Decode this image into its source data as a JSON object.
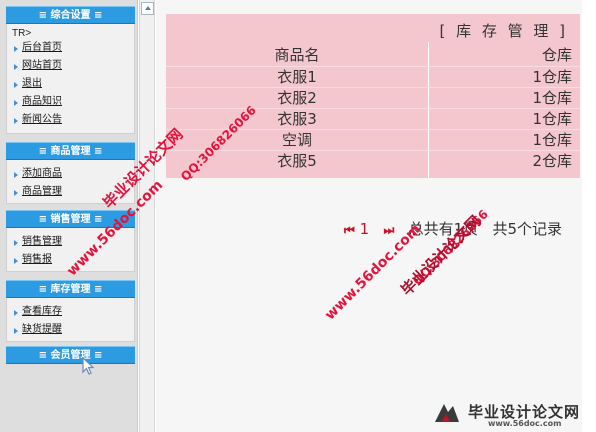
{
  "sidebar": {
    "sections": [
      {
        "title": "≡ 综合设置 ≡",
        "items": [
          "后台首页",
          "网站首页",
          "退出",
          "商品知识",
          "新闻公告"
        ]
      },
      {
        "title": "≡ 商品管理 ≡",
        "items": [
          "添加商品",
          "商品管理"
        ]
      },
      {
        "title": "≡ 销售管理 ≡",
        "items": [
          "销售管理",
          "销售报"
        ]
      },
      {
        "title": "≡ 库存管理 ≡",
        "items": [
          "查看库存",
          "缺货提醒"
        ]
      },
      {
        "title": "≡ 会员管理 ≡",
        "items": []
      }
    ],
    "tr_label": "TR>"
  },
  "table": {
    "title": "[ 库 存 管 理 ]",
    "headers": [
      "商品名",
      "仓库"
    ],
    "rows": [
      [
        "衣服1",
        "1仓库"
      ],
      [
        "衣服2",
        "1仓库"
      ],
      [
        "衣服3",
        "1仓库"
      ],
      [
        "空调",
        "1仓库"
      ],
      [
        "衣服5",
        "2仓库"
      ]
    ],
    "colors": {
      "background": "#f4c7cf",
      "text": "#333333"
    }
  },
  "pager": {
    "first_icon": "first-page-icon",
    "current_page": "1",
    "last_icon": "last-page-icon",
    "total_pages_text": "总共有1页",
    "total_records_text": "共5个记录"
  },
  "watermarks": {
    "site_name": "毕业设计论文网",
    "qq": "QQ:306826066",
    "url": "www.56doc.com"
  },
  "footer_logo": {
    "text": "毕业设计论文网",
    "url": "www.56doc.com"
  },
  "colors": {
    "section_header": "#2d9be2",
    "accent_red": "#cc1122",
    "watermark_red": "#e5123a"
  }
}
